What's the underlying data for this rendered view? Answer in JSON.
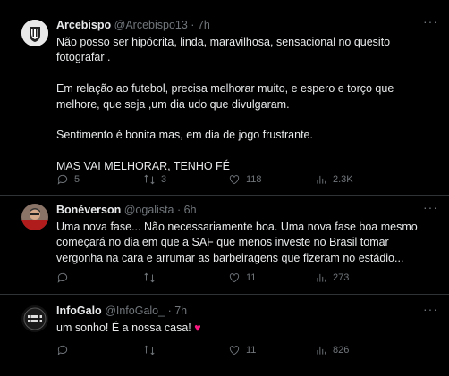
{
  "posts": [
    {
      "name": "Arcebispo",
      "handle": "@Arcebispo13",
      "dot": "·",
      "time": "7h",
      "lines": [
        "Não posso ser hipócrita, linda, maravilhosa, sensacional no quesito",
        "fotografar .",
        "",
        "Em relação ao futebol, precisa melhorar muito, e espero e torço que",
        "melhore, que seja ,um dia  udo que divulgaram.",
        "",
        "Sentimento é bonita mas, em dia de jogo frustrante.",
        "",
        "MAS VAI MELHORAR, TENHO FÉ"
      ],
      "stats": {
        "replies": "5",
        "reposts": "3",
        "likes": "118",
        "views": "2.3K"
      }
    },
    {
      "name": "Bonéverson",
      "handle": "@ogalista",
      "dot": "·",
      "time": "6h",
      "lines": [
        "Uma nova fase... Não necessariamente boa. Uma nova fase boa mesmo",
        "começará no dia em que a SAF que menos investe no Brasil tomar",
        "vergonha na cara e arrumar as barbeiragens que fizeram no estádio..."
      ],
      "stats": {
        "replies": "",
        "reposts": "",
        "likes": "11",
        "views": "273"
      }
    },
    {
      "name": "InfoGalo",
      "handle": "@InfoGalo_",
      "dot": "·",
      "time": "7h",
      "lines": [
        "um sonho! É a nossa casa!"
      ],
      "emoji": "♥",
      "stats": {
        "replies": "",
        "reposts": "",
        "likes": "11",
        "views": "826"
      }
    }
  ],
  "icons": [
    "reply-icon",
    "repost-icon",
    "like-icon",
    "views-icon",
    "more-icon"
  ],
  "colors": {
    "background": "#000000",
    "text": "#e7e9ea",
    "muted": "#71767b",
    "divider": "#2f3336",
    "heart": "#f91880"
  }
}
